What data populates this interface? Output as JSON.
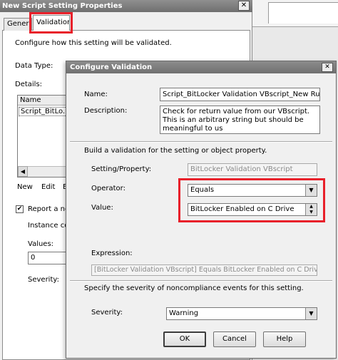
{
  "back_window": {
    "title": "New Script Setting Properties",
    "close_glyph": "✕",
    "tabs": [
      {
        "label": "General"
      },
      {
        "label": "Validation"
      }
    ],
    "configure_how_label": "Configure how this setting will be validated.",
    "data_type_label": "Data Type:",
    "details_label": "Details:",
    "list_header": "Name",
    "list_row": "Script_BitLo...",
    "new_button": "New",
    "edit_button": "Edit",
    "third_button": "E",
    "report_checkbox_checked": true,
    "report_label": "Report a non",
    "instance_label": "Instance cou",
    "values_label": "Values:",
    "values_value": "0",
    "severity_label": "Severity:"
  },
  "dialog": {
    "title": "Configure Validation",
    "close_glyph": "✕",
    "name_label": "Name:",
    "name_value": "Script_BitLocker Validation VBscript_New Rule",
    "description_label": "Description:",
    "description_value": "Check for return value from our VBscript. This is an arbitrary string but should be meaningful to us",
    "build_label": "Build a validation for the setting or object property.",
    "setting_label": "Setting/Property:",
    "setting_value": "BitLocker Validation VBscript",
    "operator_label": "Operator:",
    "operator_value": "Equals",
    "value_label": "Value:",
    "value_value": "BitLocker Enabled on C Drive",
    "expression_label": "Expression:",
    "expression_value": "[BitLocker Validation VBscript] Equals BitLocker Enabled on C Drive",
    "specify_label": "Specify the severity of noncompliance events for this setting.",
    "severity_label": "Severity:",
    "severity_value": "Warning",
    "ok_label": "OK",
    "cancel_label": "Cancel",
    "help_label": "Help"
  },
  "icons": {
    "dropdown": "chevron-down-icon",
    "spin": "spinner-arrows-icon",
    "check": "checkmark-icon"
  },
  "colors": {
    "highlight": "#e8202a",
    "titlebar": "#7a7a7a"
  }
}
